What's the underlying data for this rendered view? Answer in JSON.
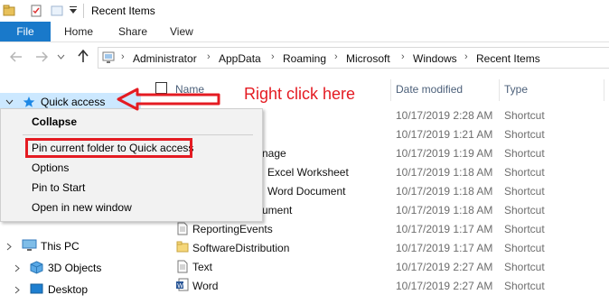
{
  "window": {
    "title": "Recent Items"
  },
  "ribbon": {
    "tabs": [
      "File",
      "Home",
      "Share",
      "View"
    ]
  },
  "address": {
    "crumbs": [
      "Administrator",
      "AppData",
      "Roaming",
      "Microsoft",
      "Windows",
      "Recent Items"
    ]
  },
  "nav": {
    "quick_access": "Quick access",
    "this_pc": "This PC",
    "objects_3d": "3D Objects",
    "desktop": "Desktop"
  },
  "columns": {
    "name": "Name",
    "date": "Date modified",
    "type": "Type"
  },
  "files": [
    {
      "name": "",
      "date": "10/17/2019 2:28 AM",
      "type": "Shortcut"
    },
    {
      "name": "",
      "date": "10/17/2019 1:21 AM",
      "type": "Shortcut"
    },
    {
      "name": "nage",
      "date": "10/17/2019 1:19 AM",
      "type": "Shortcut"
    },
    {
      "name": "Excel Worksheet",
      "date": "10/17/2019 1:18 AM",
      "type": "Shortcut"
    },
    {
      "name": "Word Document",
      "date": "10/17/2019 1:18 AM",
      "type": "Shortcut"
    },
    {
      "name": "ument",
      "date": "10/17/2019 1:18 AM",
      "type": "Shortcut"
    },
    {
      "name": "ReportingEvents",
      "date": "10/17/2019 1:17 AM",
      "type": "Shortcut"
    },
    {
      "name": "SoftwareDistribution",
      "date": "10/17/2019 1:17 AM",
      "type": "Shortcut"
    },
    {
      "name": "Text",
      "date": "10/17/2019 2:27 AM",
      "type": "Shortcut"
    },
    {
      "name": "Word",
      "date": "10/17/2019 2:27 AM",
      "type": "Shortcut"
    }
  ],
  "context_menu": {
    "collapse": "Collapse",
    "pin": "Pin current folder to Quick access",
    "options": "Options",
    "pin_start": "Pin to Start",
    "new_window": "Open in new window"
  },
  "annotation": {
    "text": "Right click here",
    "color": "#e41b22"
  },
  "colors": {
    "accent": "#1979ca",
    "selection": "#cce8ff"
  }
}
